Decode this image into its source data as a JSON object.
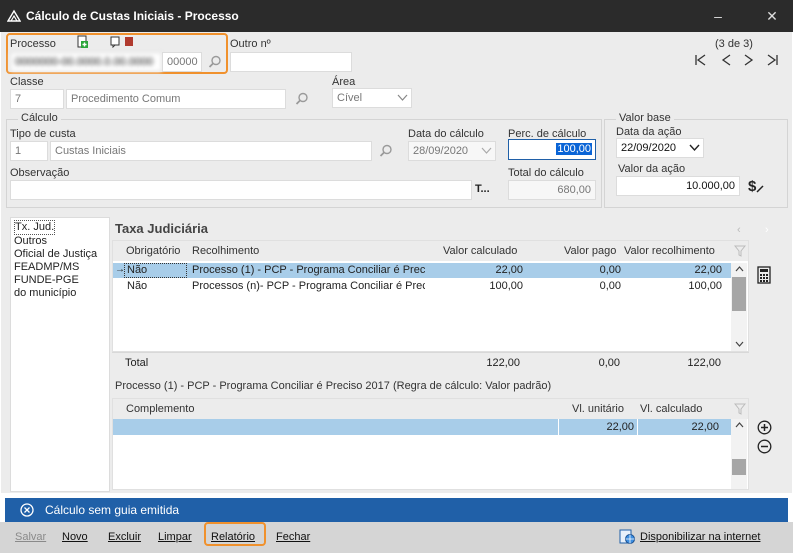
{
  "window": {
    "title": "Cálculo de Custas Iniciais - Processo"
  },
  "processo": {
    "label": "Processo",
    "number_masked": "0000000-00.0000.0.00.0000",
    "suffix": "00000"
  },
  "outro": {
    "label": "Outro nº",
    "value": ""
  },
  "navigation": {
    "position": "(3 de 3)"
  },
  "classe": {
    "label": "Classe",
    "code": "7",
    "desc": "Procedimento Comum"
  },
  "area": {
    "label": "Área",
    "value": "Cível"
  },
  "calculo": {
    "group_label": "Cálculo",
    "tipo_label": "Tipo de custa",
    "tipo_code": "1",
    "tipo_desc": "Custas Iniciais",
    "data_label": "Data do cálculo",
    "data_value": "28/09/2020",
    "perc_label": "Perc. de cálculo",
    "perc_value": "100,00",
    "obs_label": "Observação",
    "obs_value": "",
    "obs_btn": "T...",
    "total_label": "Total do cálculo",
    "total_value": "680,00"
  },
  "valor_base": {
    "group_label": "Valor base",
    "data_label": "Data da ação",
    "data_value": "22/09/2020",
    "valor_label": "Valor da ação",
    "valor_value": "10.000,00"
  },
  "sidebar": {
    "items": [
      "Tx. Jud.",
      "Outros",
      "Oficial de Justiça",
      "FEADMP/MS",
      "FUNDE-PGE",
      "do município"
    ]
  },
  "taxa": {
    "title": "Taxa Judiciária",
    "headers": {
      "obrigatorio": "Obrigatório",
      "recolhimento": "Recolhimento",
      "valor_calculado": "Valor calculado",
      "valor_pago": "Valor pago",
      "valor_recolhimento": "Valor recolhimento"
    },
    "rows": [
      {
        "marker": "→",
        "obrigatorio": "Não",
        "recolhimento": "Processo (1) - PCP - Programa Conciliar é Preci",
        "valor_calculado": "22,00",
        "valor_pago": "0,00",
        "valor_recolhimento": "22,00"
      },
      {
        "marker": "",
        "obrigatorio": "Não",
        "recolhimento": "Processos (n)- PCP - Programa Conciliar é Prec",
        "valor_calculado": "100,00",
        "valor_pago": "0,00",
        "valor_recolhimento": "100,00"
      }
    ],
    "total": {
      "label": "Total",
      "valor_calculado": "122,00",
      "valor_pago": "0,00",
      "valor_recolhimento": "122,00"
    }
  },
  "detalhe": {
    "caption": "Processo (1) - PCP - Programa Conciliar é Preciso 2017 (Regra de cálculo: Valor padrão)",
    "headers": {
      "complemento": "Complemento",
      "vl_unitario": "Vl. unitário",
      "vl_calculado": "Vl. calculado"
    },
    "rows": [
      {
        "complemento": "",
        "vl_unitario": "22,00",
        "vl_calculado": "22,00"
      }
    ]
  },
  "status": {
    "text": "Cálculo sem guia emitida",
    "color": "#2060a8"
  },
  "toolbar": {
    "salvar": "Salvar",
    "novo": "Novo",
    "excluir": "Excluir",
    "limpar": "Limpar",
    "relatorio": "Relatório",
    "fechar": "Fechar",
    "disponibilizar": "Disponibilizar na internet"
  },
  "colors": {
    "accent": "#f0912d",
    "selection": "#a8cde9",
    "titlebar": "#2b2b2b"
  }
}
